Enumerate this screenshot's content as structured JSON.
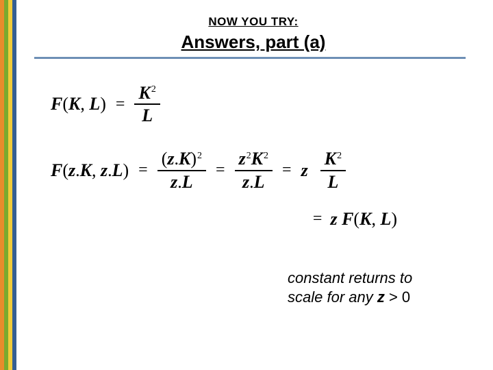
{
  "header": {
    "eyebrow": "NOW YOU TRY:",
    "title": "Answers, part (a)"
  },
  "math": {
    "row1": {
      "label_html": "F(K, L)",
      "frac_num": "K²",
      "frac_den": "L"
    },
    "row2": {
      "label_html": "F(z.K, z.L)",
      "frac1_num": "(z.K)²",
      "frac1_den": "z.L",
      "frac2_num": "z²K²",
      "frac2_den": "z.L",
      "coef": "z",
      "frac3_num": "K²",
      "frac3_den": "L"
    },
    "row3": {
      "rhs": "z F(K, L)"
    },
    "eq": "="
  },
  "caption": {
    "line1": "constant returns to",
    "line2_prefix": "scale for any ",
    "z": "z",
    "gt": " > 0"
  }
}
